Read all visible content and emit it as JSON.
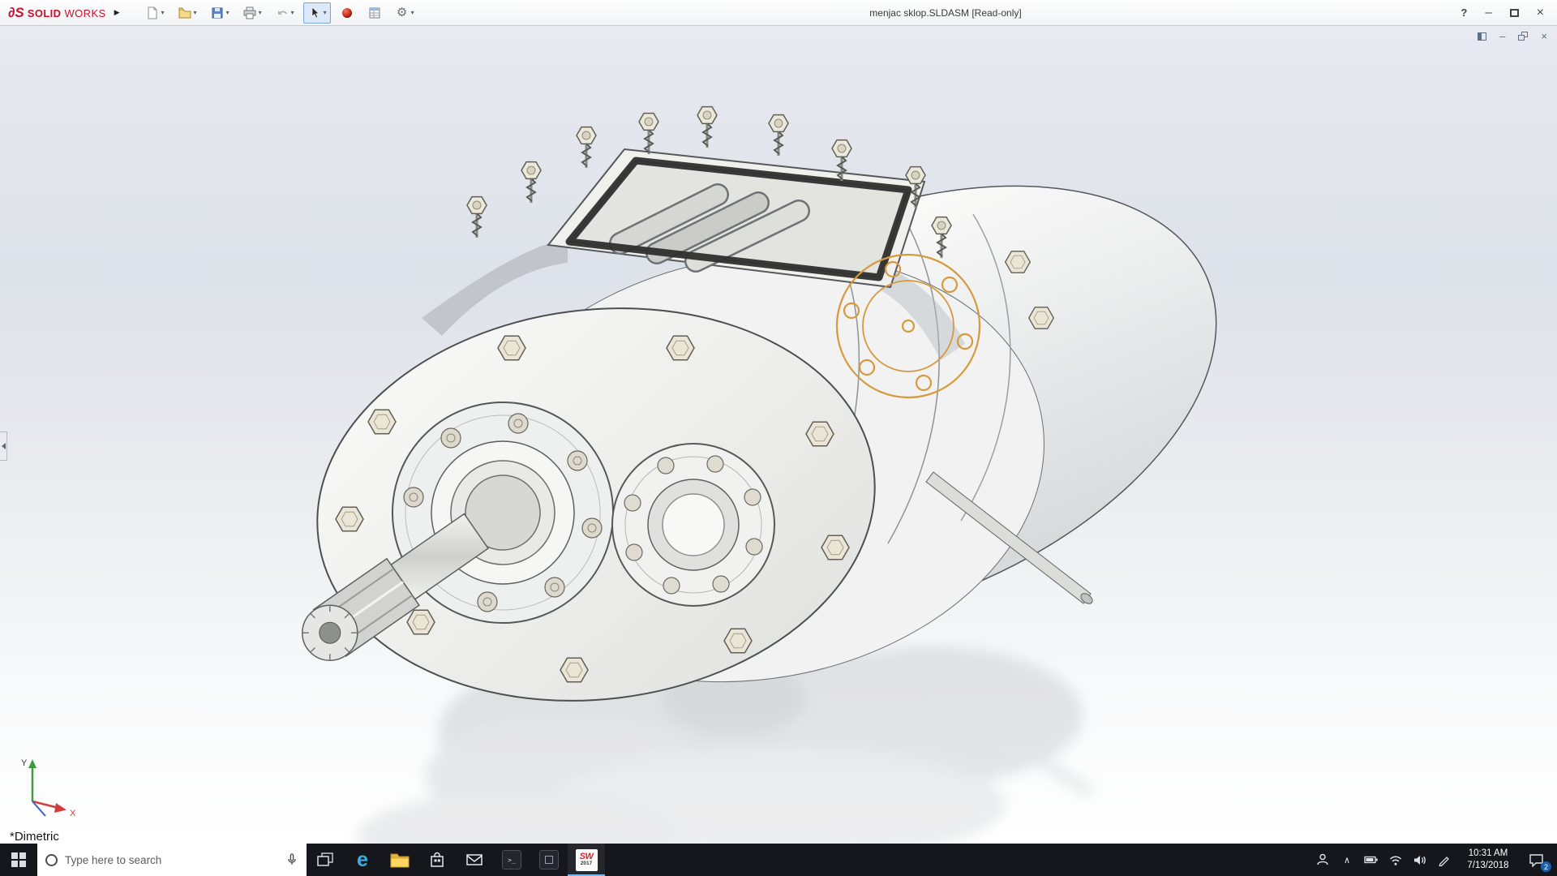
{
  "app": {
    "brand_mark": "∂S",
    "brand_bold": "SOLID",
    "brand_light": "WORKS",
    "document_title": "menjac sklop.SLDASM [Read-only]"
  },
  "glyphs": {
    "menu_arrow": "▶",
    "caret": "▾",
    "gear": "⚙",
    "help": "?",
    "minimize": "–",
    "close": "×",
    "doc_minimize": "–",
    "doc_close": "×",
    "edge": "e",
    "chevron_up": "∧"
  },
  "titlebar": {
    "toolbar_icons": [
      "new-document",
      "open",
      "save",
      "print",
      "undo",
      "select-tool",
      "appearance-sphere",
      "mass-properties",
      "options-gear"
    ],
    "select_tool_active": true
  },
  "doc_window": {
    "controls": [
      "dock",
      "minimize",
      "restore",
      "close"
    ]
  },
  "viewport": {
    "view_label": "*Dimetric",
    "triad_x_label": "X",
    "triad_y_label": "Y",
    "selection_color": "#d69a3e"
  },
  "taskbar": {
    "search_placeholder": "Type here to search",
    "icons": [
      "start",
      "cortana-search",
      "microphone",
      "task-view",
      "edge",
      "file-explorer",
      "store",
      "mail",
      "terminal-app",
      "dark-app",
      "solidworks"
    ],
    "tray_icons": [
      "people",
      "chevron-up",
      "battery",
      "wifi",
      "volume",
      "pen",
      "action-center"
    ],
    "clock_time": "10:31 AM",
    "clock_date": "7/13/2018",
    "action_badge": "2",
    "sw_label": "SW",
    "sw_year": "2017"
  },
  "colors": {
    "accent_red": "#c8102e",
    "taskbar_bg": "#15171c",
    "viewport_top": "#e7eaf0",
    "viewport_bottom": "#ffffff"
  }
}
